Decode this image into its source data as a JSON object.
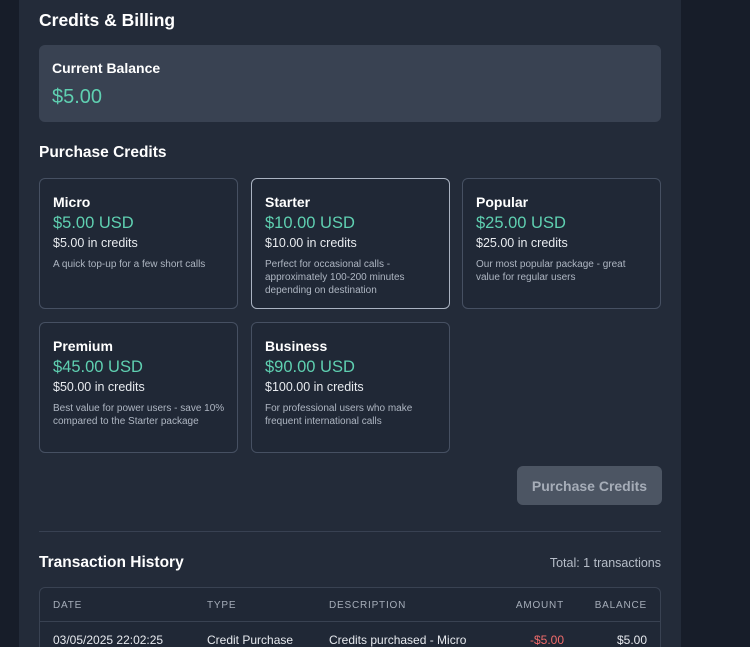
{
  "page": {
    "title": "Credits & Billing"
  },
  "balance": {
    "label": "Current Balance",
    "value": "$5.00"
  },
  "purchase": {
    "title": "Purchase Credits",
    "button_label": "Purchase Credits",
    "packages": [
      {
        "name": "Micro",
        "price": "$5.00 USD",
        "credits": "$5.00 in credits",
        "description": "A quick top-up for a few short calls",
        "selected": false
      },
      {
        "name": "Starter",
        "price": "$10.00 USD",
        "credits": "$10.00 in credits",
        "description": "Perfect for occasional calls - approximately 100-200 minutes depending on destination",
        "selected": true
      },
      {
        "name": "Popular",
        "price": "$25.00 USD",
        "credits": "$25.00 in credits",
        "description": "Our most popular package - great value for regular users",
        "selected": false
      },
      {
        "name": "Premium",
        "price": "$45.00 USD",
        "credits": "$50.00 in credits",
        "description": "Best value for power users - save 10% compared to the Starter package",
        "selected": false
      },
      {
        "name": "Business",
        "price": "$90.00 USD",
        "credits": "$100.00 in credits",
        "description": "For professional users who make frequent international calls",
        "selected": false
      }
    ]
  },
  "history": {
    "title": "Transaction History",
    "total": "Total: 1 transactions",
    "columns": [
      "DATE",
      "TYPE",
      "DESCRIPTION",
      "AMOUNT",
      "BALANCE"
    ],
    "rows": [
      {
        "date": "03/05/2025 22:02:25",
        "type": "Credit Purchase",
        "description": "Credits purchased - Micro",
        "amount": "-$5.00",
        "balance": "$5.00"
      }
    ]
  },
  "colors": {
    "accent": "#5fd0b1",
    "negative": "#ef6b6b",
    "panel": "#232b39",
    "background": "#171d29"
  }
}
